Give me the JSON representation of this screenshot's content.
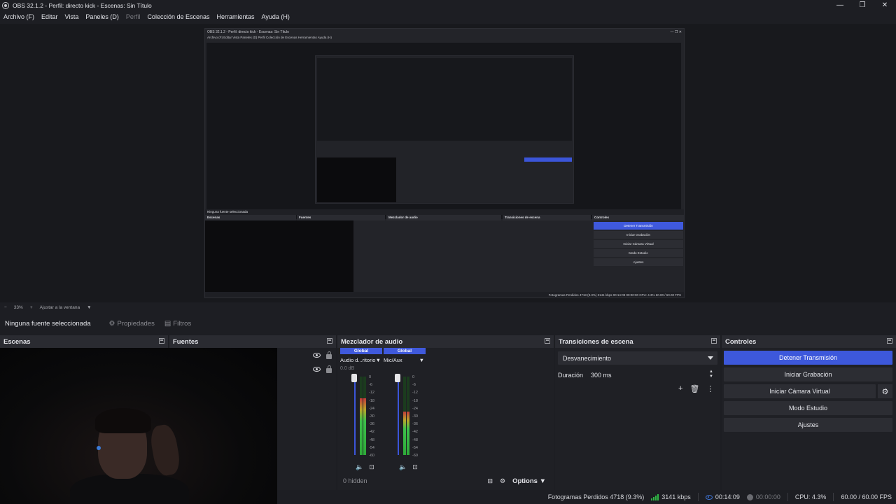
{
  "window": {
    "title": "OBS 32.1.2 - Perfil: directo kick - Escenas: Sin Título",
    "minimize": "—",
    "maximize": "❐",
    "close": "✕"
  },
  "menu": {
    "items": [
      "Archivo (F)",
      "Editar",
      "Vista",
      "Paneles (D)",
      "Perfil",
      "Colección de Escenas",
      "Herramientas",
      "Ayuda (H)"
    ]
  },
  "zoom": {
    "minus": "−",
    "level": "33%",
    "plus": "+",
    "fit": "Ajustar a la ventana"
  },
  "context": {
    "no_source": "Ninguna fuente seleccionada",
    "properties": "Propiedades",
    "filters": "Filtros"
  },
  "docks": {
    "scenes": "Escenas",
    "sources": "Fuentes",
    "mixer": "Mezclador de audio",
    "transitions": "Transiciones de escena",
    "controls": "Controles"
  },
  "mixer": {
    "channels": [
      {
        "badge": "Global",
        "name": "Audio d...ritorio",
        "db": "0.0 dB",
        "level": 0.72
      },
      {
        "badge": "Global",
        "name": "Mic/Aux",
        "db": "0.0 dB",
        "level": 0.55
      }
    ],
    "scale": [
      "0",
      "-6",
      "-12",
      "-18",
      "-24",
      "-30",
      "-36",
      "-42",
      "-48",
      "-54",
      "-60"
    ],
    "hidden": "0 hidden",
    "options": "Options"
  },
  "transitions": {
    "selected": "Desvanecimiento",
    "duration_label": "Duración",
    "duration_value": "300 ms"
  },
  "controls": {
    "stop_stream": "Detener Transmisión",
    "start_record": "Iniciar Grabación",
    "virtual_cam": "Iniciar Cámara Virtual",
    "studio_mode": "Modo Estudio",
    "settings": "Ajustes"
  },
  "status": {
    "dropped": "Fotogramas Perdidos 4718 (9.3%)",
    "bitrate": "3141 kbps",
    "live_time": "00:14:09",
    "rec_time": "00:00:00",
    "cpu": "CPU: 4.3%",
    "fps": "60.00 / 60.00 FPS"
  },
  "nested": {
    "title": "OBS 32.1.2 - Perfil: directo kick - Escenas: Sin Título",
    "menu": "Archivo (F)   Editar   Vista   Paneles (D)   Perfil   Colección de Escenas   Herramientas   Ayuda (H)",
    "no_source": "Ninguna fuente seleccionada",
    "scenes": "Escenas",
    "sources": "Fuentes",
    "mixer": "Mezclador de audio",
    "transitions": "Transiciones de escena",
    "controls": "Controles",
    "stop_stream": "Detener Transmisión",
    "start_record": "Iniciar Grabación",
    "virtual_cam": "Iniciar Cámara Virtual",
    "studio_mode": "Modo Estudio",
    "settings": "Ajustes",
    "status": "Fotogramas Perdidos 4718 (9.3%)   3141 kbps   00:14:09   00:00:00   CPU: 4.3%   60.00 / 60.00 FPS"
  },
  "colors": {
    "accent": "#3d58db",
    "meter_green": "#2fb844",
    "background": "#1d1e23"
  }
}
